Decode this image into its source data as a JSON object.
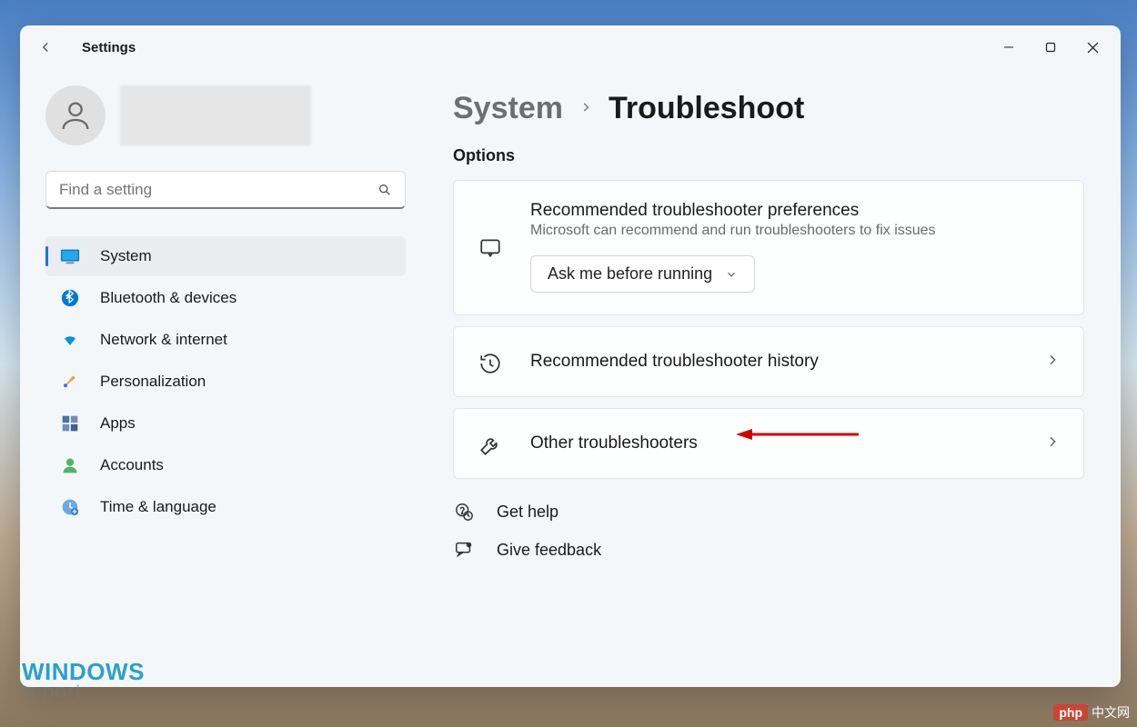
{
  "window": {
    "title": "Settings"
  },
  "search": {
    "placeholder": "Find a setting"
  },
  "sidebar": {
    "items": [
      {
        "label": "System",
        "icon": "system",
        "active": true
      },
      {
        "label": "Bluetooth & devices",
        "icon": "bluetooth"
      },
      {
        "label": "Network & internet",
        "icon": "wifi"
      },
      {
        "label": "Personalization",
        "icon": "brush"
      },
      {
        "label": "Apps",
        "icon": "apps"
      },
      {
        "label": "Accounts",
        "icon": "account"
      },
      {
        "label": "Time & language",
        "icon": "clock"
      }
    ]
  },
  "breadcrumb": {
    "parent": "System",
    "current": "Troubleshoot"
  },
  "main": {
    "options_label": "Options",
    "recommended_pref": {
      "title": "Recommended troubleshooter preferences",
      "subtitle": "Microsoft can recommend and run troubleshooters to fix issues",
      "dropdown_value": "Ask me before running"
    },
    "history": {
      "title": "Recommended troubleshooter history"
    },
    "other": {
      "title": "Other troubleshooters"
    },
    "help": {
      "get_help": "Get help",
      "feedback": "Give feedback"
    }
  },
  "watermark": {
    "line1": "WINDOWS",
    "line2": "report"
  },
  "badge": {
    "brand": "php",
    "text": "中文网"
  }
}
